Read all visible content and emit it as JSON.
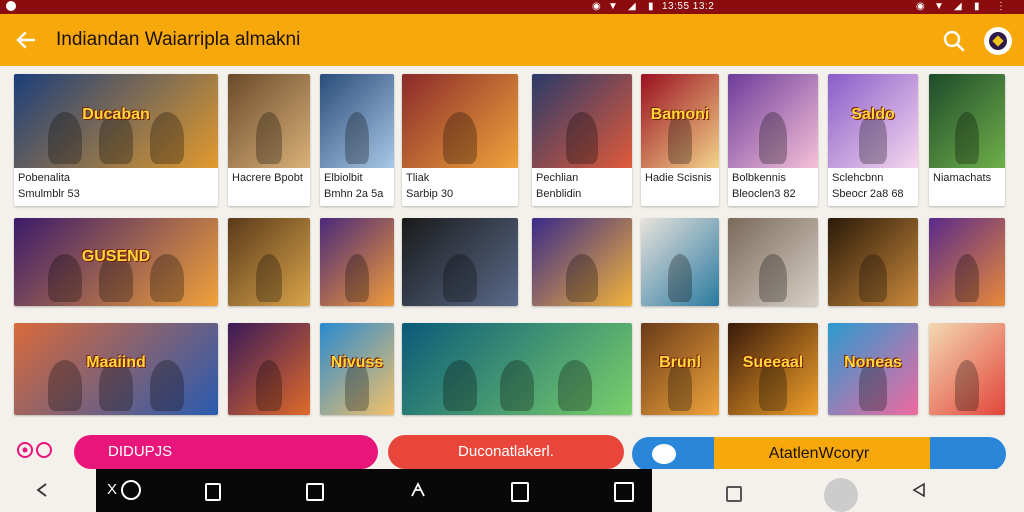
{
  "status_bar": {
    "time": "13:55  13:2"
  },
  "app_bar": {
    "title": "Indiandan Waiarripla almakni"
  },
  "tiles": [
    {
      "caption1": "Pobenalita",
      "caption2": "Smulmblr 53",
      "overlay": "Ducaban"
    },
    {
      "caption1": "Hacrere Bpobt",
      "caption2": "",
      "overlay": ""
    },
    {
      "caption1": "Elbiolbit",
      "caption2": "Bmhn 2a 5a",
      "overlay": ""
    },
    {
      "caption1": "Tliak",
      "caption2": "Sarbip 30",
      "overlay": ""
    },
    {
      "caption1": "Pechlian",
      "caption2": "Benblidin",
      "overlay": ""
    },
    {
      "caption1": "Hadie Scisnis",
      "caption2": "",
      "overlay": "Bamoni"
    },
    {
      "caption1": "Bolbkennis",
      "caption2": "Bleoclen3 82",
      "overlay": ""
    },
    {
      "caption1": "Sclehcbnn",
      "caption2": "Sbeocr 2a8 68",
      "overlay": "Saldo"
    },
    {
      "caption1": "Niamachats",
      "caption2": "",
      "overlay": ""
    },
    {
      "caption1": "",
      "caption2": "",
      "overlay": "GUSEND"
    },
    {
      "caption1": "",
      "caption2": "",
      "overlay": ""
    },
    {
      "caption1": "",
      "caption2": "",
      "overlay": ""
    },
    {
      "caption1": "",
      "caption2": "",
      "overlay": ""
    },
    {
      "caption1": "",
      "caption2": "",
      "overlay": ""
    },
    {
      "caption1": "",
      "caption2": "",
      "overlay": ""
    },
    {
      "caption1": "",
      "caption2": "",
      "overlay": ""
    },
    {
      "caption1": "",
      "caption2": "",
      "overlay": ""
    },
    {
      "caption1": "",
      "caption2": "",
      "overlay": ""
    },
    {
      "caption1": "",
      "caption2": "",
      "overlay": "Maaiind"
    },
    {
      "caption1": "",
      "caption2": "",
      "overlay": ""
    },
    {
      "caption1": "",
      "caption2": "",
      "overlay": "Nivuss"
    },
    {
      "caption1": "",
      "caption2": "",
      "overlay": ""
    },
    {
      "caption1": "",
      "caption2": "",
      "overlay": "Brunl"
    },
    {
      "caption1": "",
      "caption2": "",
      "overlay": "Sueeaal"
    },
    {
      "caption1": "",
      "caption2": "",
      "overlay": "Noneas"
    },
    {
      "caption1": "",
      "caption2": "",
      "overlay": ""
    }
  ],
  "bottom_buttons": {
    "pink_label": "DIDUPJS",
    "red_label": "Duconatlakerl.",
    "blue_label": "AtatlenWcoryr"
  },
  "nav": {
    "x_label": "X"
  },
  "colors": {
    "status_bar": "#8a0c0c",
    "app_bar": "#f7a90b",
    "pink": "#e8157a",
    "red": "#e8463a",
    "blue": "#2a86d9"
  }
}
